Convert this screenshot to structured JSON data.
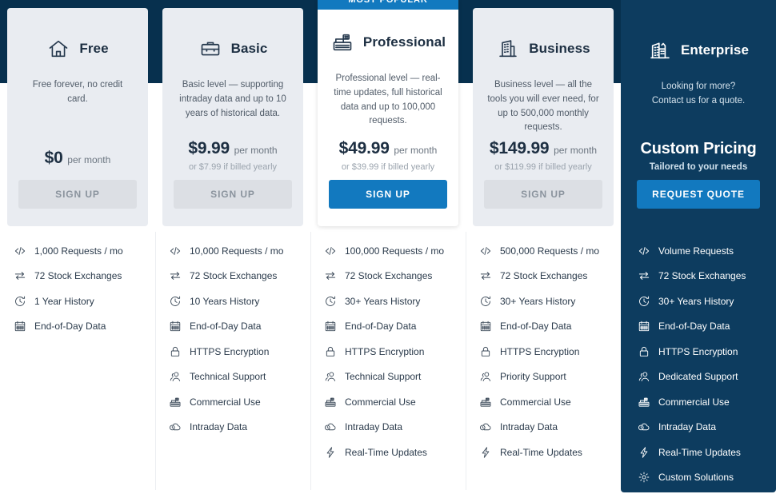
{
  "theme": {
    "navy_band": "#07304e",
    "card_bg": "#e9ecf1",
    "featured_bg": "#ffffff",
    "accent_blue": "#1279bf",
    "enterprise_bg": "#0d3c5f",
    "muted_button": "#dcdfe4",
    "text_dark": "#1d2f42",
    "text_muted": "#6b7580"
  },
  "plans": [
    {
      "id": "free",
      "name": "Free",
      "icon": "home-icon",
      "badge": null,
      "description": "Free forever, no credit card.",
      "price": "$0",
      "price_period": "per month",
      "price_yearly": "",
      "cta_label": "SIGN UP",
      "featured": false,
      "features": [
        {
          "icon": "code-icon",
          "label": "1,000 Requests / mo"
        },
        {
          "icon": "exchange-icon",
          "label": "72 Stock Exchanges"
        },
        {
          "icon": "history-icon",
          "label": "1 Year History"
        },
        {
          "icon": "calendar-icon",
          "label": "End-of-Day Data"
        }
      ]
    },
    {
      "id": "basic",
      "name": "Basic",
      "icon": "briefcase-icon",
      "badge": null,
      "description": "Basic level — supporting intraday data and up to 10 years of historical data.",
      "price": "$9.99",
      "price_period": "per month",
      "price_yearly": "or $7.99 if billed yearly",
      "cta_label": "SIGN UP",
      "featured": false,
      "features": [
        {
          "icon": "code-icon",
          "label": "10,000 Requests / mo"
        },
        {
          "icon": "exchange-icon",
          "label": "72 Stock Exchanges"
        },
        {
          "icon": "history-icon",
          "label": "10 Years History"
        },
        {
          "icon": "calendar-icon",
          "label": "End-of-Day Data"
        },
        {
          "icon": "lock-icon",
          "label": "HTTPS Encryption"
        },
        {
          "icon": "users-icon",
          "label": "Technical Support"
        },
        {
          "icon": "register-icon",
          "label": "Commercial Use"
        },
        {
          "icon": "cloud-clock-icon",
          "label": "Intraday Data"
        }
      ]
    },
    {
      "id": "professional",
      "name": "Professional",
      "icon": "cash-register-icon",
      "badge": "MOST POPULAR",
      "description": "Professional level — real-time updates, full historical data and up to 100,000 requests.",
      "price": "$49.99",
      "price_period": "per month",
      "price_yearly": "or $39.99 if billed yearly",
      "cta_label": "SIGN UP",
      "featured": true,
      "features": [
        {
          "icon": "code-icon",
          "label": "100,000 Requests / mo"
        },
        {
          "icon": "exchange-icon",
          "label": "72 Stock Exchanges"
        },
        {
          "icon": "history-icon",
          "label": "30+ Years History"
        },
        {
          "icon": "calendar-icon",
          "label": "End-of-Day Data"
        },
        {
          "icon": "lock-icon",
          "label": "HTTPS Encryption"
        },
        {
          "icon": "users-icon",
          "label": "Technical Support"
        },
        {
          "icon": "register-icon",
          "label": "Commercial Use"
        },
        {
          "icon": "cloud-clock-icon",
          "label": "Intraday Data"
        },
        {
          "icon": "bolt-icon",
          "label": "Real-Time Updates"
        }
      ]
    },
    {
      "id": "business",
      "name": "Business",
      "icon": "building-icon",
      "badge": null,
      "description": "Business level — all the tools you will ever need, for up to 500,000 monthly requests.",
      "price": "$149.99",
      "price_period": "per month",
      "price_yearly": "or $119.99 if billed yearly",
      "cta_label": "SIGN UP",
      "featured": false,
      "features": [
        {
          "icon": "code-icon",
          "label": "500,000 Requests / mo"
        },
        {
          "icon": "exchange-icon",
          "label": "72 Stock Exchanges"
        },
        {
          "icon": "history-icon",
          "label": "30+ Years History"
        },
        {
          "icon": "calendar-icon",
          "label": "End-of-Day Data"
        },
        {
          "icon": "lock-icon",
          "label": "HTTPS Encryption"
        },
        {
          "icon": "users-icon",
          "label": "Priority Support"
        },
        {
          "icon": "register-icon",
          "label": "Commercial Use"
        },
        {
          "icon": "cloud-clock-icon",
          "label": "Intraday Data"
        },
        {
          "icon": "bolt-icon",
          "label": "Real-Time Updates"
        }
      ]
    },
    {
      "id": "enterprise",
      "name": "Enterprise",
      "icon": "office-building-icon",
      "badge": null,
      "description": "Looking for more?\nContact us for a quote.",
      "price": "Custom Pricing",
      "price_period": "",
      "price_yearly": "Tailored to your needs",
      "cta_label": "REQUEST QUOTE",
      "featured": false,
      "dark": true,
      "features": [
        {
          "icon": "code-icon",
          "label": "Volume Requests"
        },
        {
          "icon": "exchange-icon",
          "label": "72 Stock Exchanges"
        },
        {
          "icon": "history-icon",
          "label": "30+ Years History"
        },
        {
          "icon": "calendar-icon",
          "label": "End-of-Day Data"
        },
        {
          "icon": "lock-icon",
          "label": "HTTPS Encryption"
        },
        {
          "icon": "users-icon",
          "label": "Dedicated Support"
        },
        {
          "icon": "register-icon",
          "label": "Commercial Use"
        },
        {
          "icon": "cloud-clock-icon",
          "label": "Intraday Data"
        },
        {
          "icon": "bolt-icon",
          "label": "Real-Time Updates"
        },
        {
          "icon": "gear-icon",
          "label": "Custom Solutions"
        }
      ]
    }
  ]
}
